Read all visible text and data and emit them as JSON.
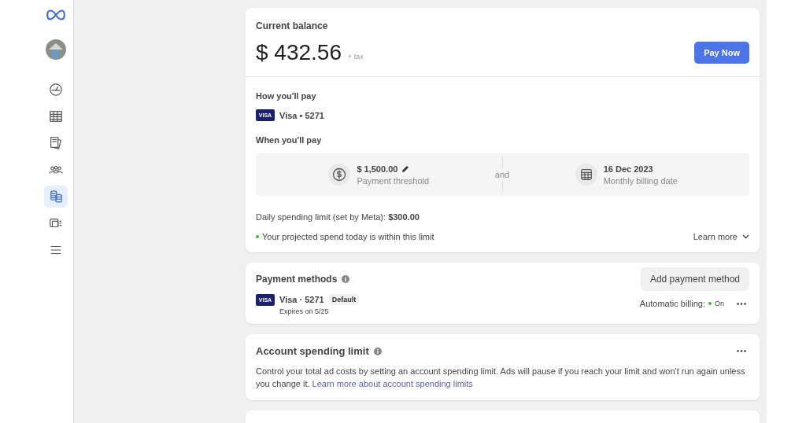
{
  "sidebar": {
    "items": [
      {
        "selected": false
      },
      {
        "selected": false
      },
      {
        "selected": false
      },
      {
        "selected": false
      },
      {
        "selected": true
      },
      {
        "selected": false
      },
      {
        "selected": false
      }
    ]
  },
  "balance_card": {
    "title": "Current balance",
    "amount": "$ 432.56",
    "tax_note": "+ tax",
    "pay_button": "Pay Now",
    "how_title": "How you'll pay",
    "card": {
      "brand": "VISA",
      "label": "Visa • 5271"
    },
    "when_title": "When you'll pay",
    "threshold": {
      "value": "$ 1,500.00",
      "label": "Payment threshold"
    },
    "connector": "and",
    "billing_date": {
      "value": "16 Dec 2023",
      "label": "Monthly billing date"
    },
    "daily_limit": "Daily spending limit (set by Meta): **$300.00**",
    "projection": {
      "text": "Your projected spend today is within this limit",
      "color": "#42b72a"
    },
    "learn_more": "Learn more"
  },
  "payment_methods": {
    "title": "Payment methods",
    "add_button": "Add payment method",
    "methods": [
      {
        "brand": "VISA",
        "label": "Visa · 5271",
        "badge": "Default",
        "expiry": "Expires on 5/25",
        "auto_billing_label": "Automatic billing:",
        "auto_billing_on": true,
        "auto_billing_text": "On"
      }
    ]
  },
  "spending_limit": {
    "title": "Account spending limit",
    "text": "Control your total ad costs by setting an account spending limit. Ads will pause if you reach your limit and won't run again unless you change it.",
    "link": "Learn more about account spending limits"
  }
}
